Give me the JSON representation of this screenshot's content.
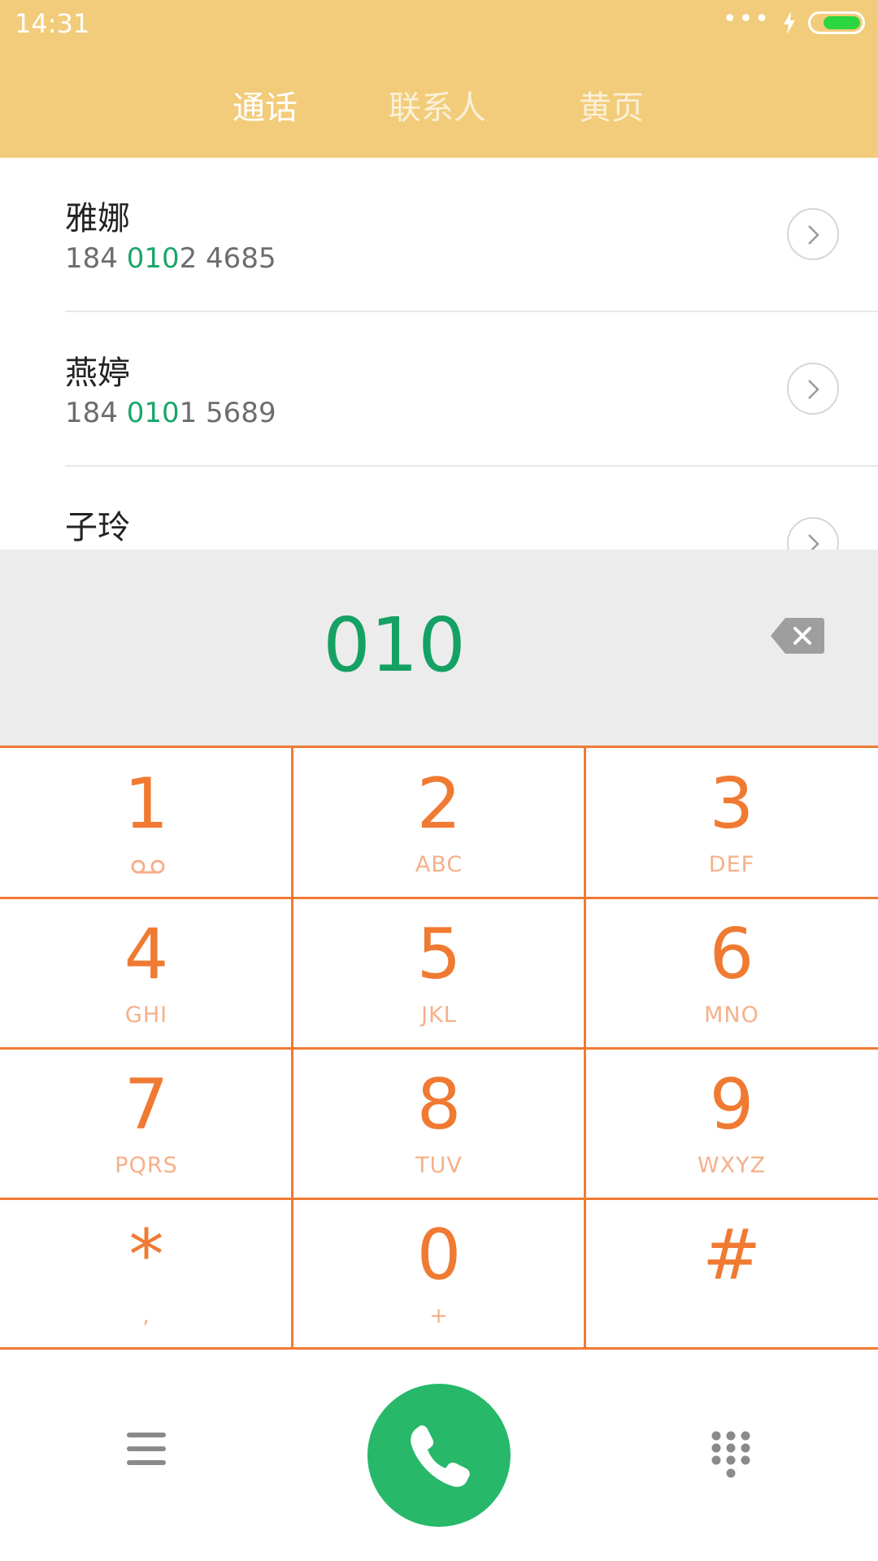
{
  "status_bar": {
    "time": "14:31",
    "signal_dots": "•••",
    "battery_color": "#2bd63e"
  },
  "tabs": [
    {
      "label": "通话",
      "active": true
    },
    {
      "label": "联系人",
      "active": false
    },
    {
      "label": "黄页",
      "active": false
    }
  ],
  "contacts": [
    {
      "name": "雅娜",
      "number_prefix": "184 ",
      "number_match": "010",
      "number_suffix": "2 4685"
    },
    {
      "name": "燕婷",
      "number_prefix": "184 ",
      "number_match": "010",
      "number_suffix": "1 5689"
    },
    {
      "name": "子玲",
      "number_prefix": "",
      "number_match": "",
      "number_suffix": ""
    }
  ],
  "dialer": {
    "dialed_number": "010",
    "backspace_icon": "backspace-icon"
  },
  "keypad": [
    {
      "digit": "1",
      "letters": ""
    },
    {
      "digit": "2",
      "letters": "ABC"
    },
    {
      "digit": "3",
      "letters": "DEF"
    },
    {
      "digit": "4",
      "letters": "GHI"
    },
    {
      "digit": "5",
      "letters": "JKL"
    },
    {
      "digit": "6",
      "letters": "MNO"
    },
    {
      "digit": "7",
      "letters": "PQRS"
    },
    {
      "digit": "8",
      "letters": "TUV"
    },
    {
      "digit": "9",
      "letters": "WXYZ"
    },
    {
      "digit": "*",
      "letters": ","
    },
    {
      "digit": "0",
      "letters": "+"
    },
    {
      "digit": "#",
      "letters": ""
    }
  ],
  "colors": {
    "header_bg": "#f2cc7a",
    "accent_orange": "#f07a32",
    "match_green": "#1aa56a",
    "call_green": "#27b86a"
  },
  "bottom_bar": {
    "menu_icon": "menu-icon",
    "call_icon": "phone-icon",
    "dialpad_icon": "dialpad-icon"
  }
}
